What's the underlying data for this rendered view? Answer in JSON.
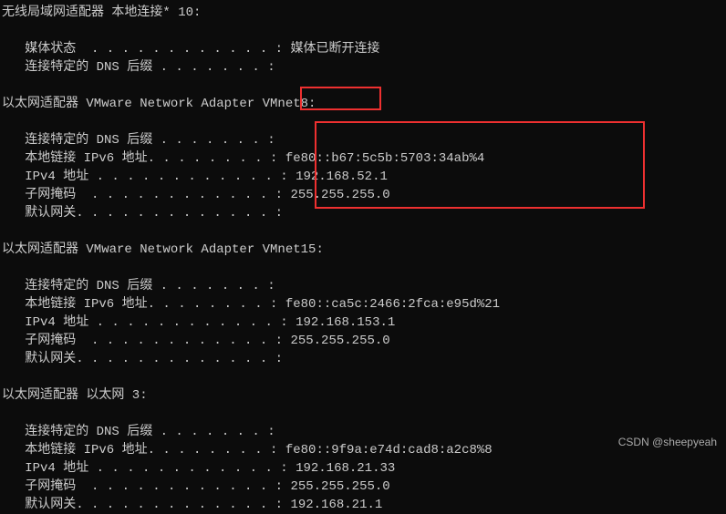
{
  "adapter1": {
    "header": "无线局域网适配器 本地连接* 10:",
    "media_state_label": "   媒体状态  . . . . . . . . . . . . : ",
    "media_state_value": "媒体已断开连接",
    "dns_suffix_label": "   连接特定的 DNS 后缀 . . . . . . . :"
  },
  "adapter2": {
    "header": "以太网适配器 VMware Network Adapter VMnet8:",
    "dns_suffix_label": "   连接特定的 DNS 后缀 . . . . . . . :",
    "ipv6_label": "   本地链接 IPv6 地址. . . . . . . . : ",
    "ipv6_value": "fe80::b67:5c5b:5703:34ab%4",
    "ipv4_label": "   IPv4 地址 . . . . . . . . . . . . : ",
    "ipv4_value": "192.168.52.1",
    "subnet_label": "   子网掩码  . . . . . . . . . . . . : ",
    "subnet_value": "255.255.255.0",
    "gateway_label": "   默认网关. . . . . . . . . . . . . :"
  },
  "adapter3": {
    "header": "以太网适配器 VMware Network Adapter VMnet15:",
    "dns_suffix_label": "   连接特定的 DNS 后缀 . . . . . . . :",
    "ipv6_label": "   本地链接 IPv6 地址. . . . . . . . : ",
    "ipv6_value": "fe80::ca5c:2466:2fca:e95d%21",
    "ipv4_label": "   IPv4 地址 . . . . . . . . . . . . : ",
    "ipv4_value": "192.168.153.1",
    "subnet_label": "   子网掩码  . . . . . . . . . . . . : ",
    "subnet_value": "255.255.255.0",
    "gateway_label": "   默认网关. . . . . . . . . . . . . :"
  },
  "adapter4": {
    "header": "以太网适配器 以太网 3:",
    "dns_suffix_label": "   连接特定的 DNS 后缀 . . . . . . . :",
    "ipv6_label": "   本地链接 IPv6 地址. . . . . . . . : ",
    "ipv6_value": "fe80::9f9a:e74d:cad8:a2c8%8",
    "ipv4_label": "   IPv4 地址 . . . . . . . . . . . . : ",
    "ipv4_value": "192.168.21.33",
    "subnet_label": "   子网掩码  . . . . . . . . . . . . : ",
    "subnet_value": "255.255.255.0",
    "gateway_label": "   默认网关. . . . . . . . . . . . . : ",
    "gateway_value": "192.168.21.1"
  },
  "watermark": "CSDN @sheepyeah"
}
